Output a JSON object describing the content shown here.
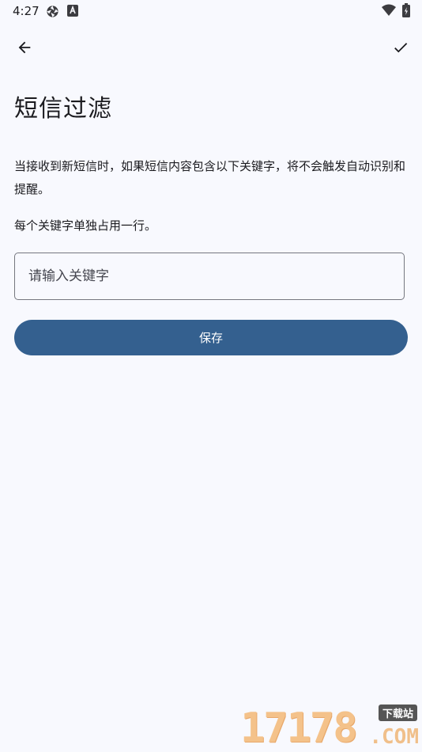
{
  "status_bar": {
    "time": "4:27"
  },
  "top_bar": {
    "back_icon": "arrow-left",
    "confirm_icon": "checkmark"
  },
  "title": "短信过滤",
  "description": "当接收到新短信时，如果短信内容包含以下关键字，将不会触发自动识别和提醒。",
  "hint": "每个关键字单独占用一行。",
  "keyword_input": {
    "placeholder": "请输入关键字",
    "value": ""
  },
  "save_button": {
    "label": "保存"
  },
  "watermark": {
    "number": "17178",
    "badge": "下载站",
    "dotcom": ".COM"
  },
  "colors": {
    "background": "#f8f9fe",
    "primary": "#34608f",
    "text": "#1b1b1f",
    "outline": "#75777f"
  }
}
